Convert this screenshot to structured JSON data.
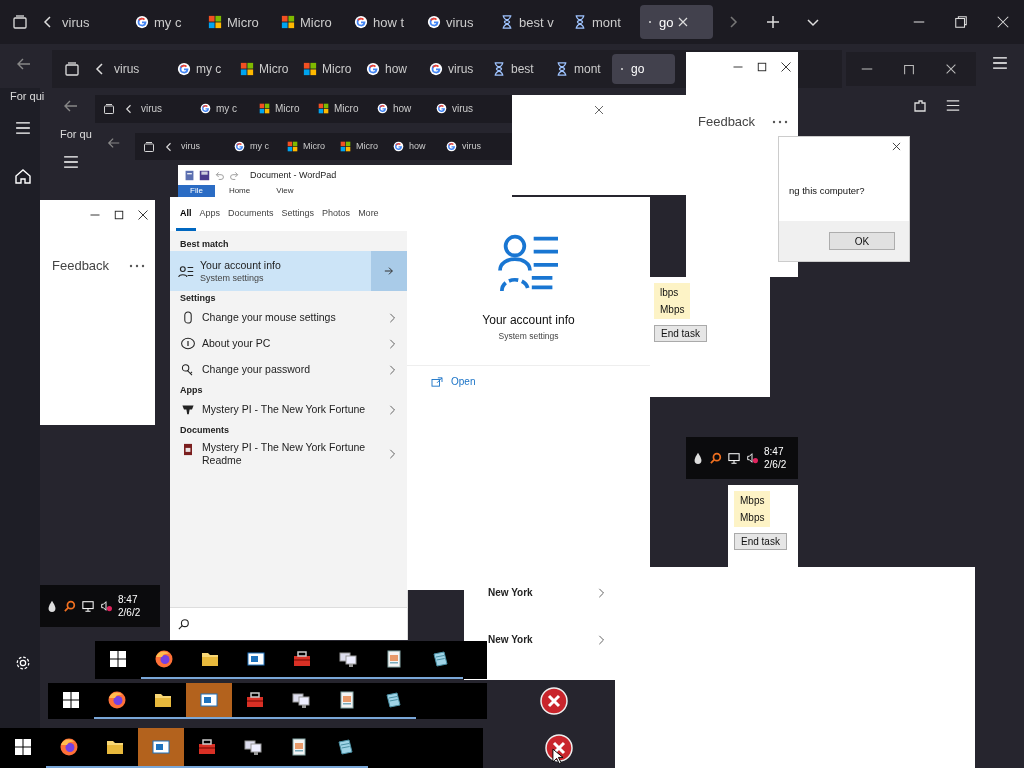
{
  "tab_bars": [
    {
      "tabs": [
        {
          "label": "virus",
          "kind": "none",
          "selected": false
        },
        {
          "label": "my c",
          "kind": "google",
          "selected": false
        },
        {
          "label": "Micro",
          "kind": "microsoft",
          "selected": false
        },
        {
          "label": "Micro",
          "kind": "microsoft",
          "selected": false
        },
        {
          "label": "how t",
          "kind": "google",
          "selected": false
        },
        {
          "label": "virus",
          "kind": "google",
          "selected": false
        },
        {
          "label": "best v",
          "kind": "hourglass",
          "selected": false
        },
        {
          "label": "mont",
          "kind": "hourglass",
          "selected": false
        },
        {
          "label": "go",
          "kind": "loading",
          "selected": true
        }
      ]
    },
    {
      "tabs": [
        {
          "label": "virus",
          "kind": "none",
          "selected": false
        },
        {
          "label": "my c",
          "kind": "google",
          "selected": false
        },
        {
          "label": "Micro",
          "kind": "microsoft",
          "selected": false
        },
        {
          "label": "Micro",
          "kind": "microsoft",
          "selected": false
        },
        {
          "label": "how",
          "kind": "google",
          "selected": false
        },
        {
          "label": "virus",
          "kind": "google",
          "selected": false
        },
        {
          "label": "best",
          "kind": "hourglass",
          "selected": false
        },
        {
          "label": "mont",
          "kind": "hourglass",
          "selected": false
        },
        {
          "label": "go",
          "kind": "loading",
          "selected": true
        }
      ]
    },
    {
      "tabs": [
        {
          "label": "virus",
          "kind": "none",
          "selected": false
        },
        {
          "label": "my c",
          "kind": "google",
          "selected": false
        },
        {
          "label": "Micro",
          "kind": "microsoft",
          "selected": false
        },
        {
          "label": "Micro",
          "kind": "microsoft",
          "selected": false
        },
        {
          "label": "how",
          "kind": "google",
          "selected": false
        },
        {
          "label": "virus",
          "kind": "google",
          "selected": false
        }
      ]
    },
    {
      "tabs": [
        {
          "label": "virus",
          "kind": "none",
          "selected": false
        },
        {
          "label": "my c",
          "kind": "google",
          "selected": false
        },
        {
          "label": "Micro",
          "kind": "microsoft",
          "selected": false
        },
        {
          "label": "Micro",
          "kind": "microsoft",
          "selected": false
        },
        {
          "label": "how",
          "kind": "google",
          "selected": false
        },
        {
          "label": "virus",
          "kind": "google",
          "selected": false
        }
      ]
    }
  ],
  "page_fragments": [
    "For qui",
    "For qu"
  ],
  "feedback_windows": [
    {
      "label": "Feedback"
    },
    {
      "label": "Feedback"
    }
  ],
  "wordpad": {
    "title": "Document - WordPad",
    "ribbon_tabs": [
      {
        "label": "File",
        "selected": true
      },
      {
        "label": "Home",
        "selected": false
      },
      {
        "label": "View",
        "selected": false
      }
    ]
  },
  "search_panel": {
    "tabs": [
      {
        "label": "All",
        "selected": true
      },
      {
        "label": "Apps",
        "selected": false
      },
      {
        "label": "Documents",
        "selected": false
      },
      {
        "label": "Settings",
        "selected": false
      },
      {
        "label": "Photos",
        "selected": false
      },
      {
        "label": "More",
        "selected": false
      }
    ],
    "sections": [
      {
        "heading": "Best match",
        "items": [
          {
            "kind": "account",
            "title": "Your account info",
            "subtitle": "System settings",
            "selected": true
          }
        ]
      },
      {
        "heading": "Settings",
        "items": [
          {
            "kind": "mouse",
            "title": "Change your mouse settings",
            "selected": false
          },
          {
            "kind": "info",
            "title": "About your PC",
            "selected": false
          },
          {
            "kind": "key",
            "title": "Change your password",
            "selected": false
          }
        ]
      },
      {
        "heading": "Apps",
        "items": [
          {
            "kind": "game",
            "title": "Mystery PI - The New York Fortune",
            "selected": false
          }
        ]
      },
      {
        "heading": "Documents",
        "items": [
          {
            "kind": "document",
            "title": "Mystery PI - The New York Fortune Readme",
            "selected": false
          }
        ]
      }
    ]
  },
  "preview": {
    "title": "Your account info",
    "subtitle": "System settings",
    "action": "Open"
  },
  "dialog": {
    "message": "ng this computer?",
    "button": "OK"
  },
  "task_manager_fragments": [
    {
      "speeds": [
        "lbps",
        "Mbps"
      ],
      "button": "End task"
    },
    {
      "speeds": [
        "Mbps",
        "Mbps"
      ],
      "button": "End task"
    }
  ],
  "clocks": [
    {
      "time": "8:47",
      "date": "2/6/2"
    },
    {
      "time": "8:47",
      "date": "2/6/2"
    }
  ],
  "results_fragments": [
    "New York",
    "New York"
  ],
  "taskbars": [
    {
      "items": [
        {
          "kind": "windows",
          "selected": false
        },
        {
          "kind": "firefox",
          "selected": false
        },
        {
          "kind": "folder",
          "selected": false
        },
        {
          "kind": "app",
          "selected": false
        },
        {
          "kind": "toolbox",
          "selected": false
        },
        {
          "kind": "monitor",
          "selected": false
        },
        {
          "kind": "notepad",
          "selected": false
        },
        {
          "kind": "pad",
          "selected": false
        }
      ]
    },
    {
      "items": [
        {
          "kind": "windows",
          "selected": false
        },
        {
          "kind": "firefox",
          "selected": false
        },
        {
          "kind": "folder",
          "selected": false
        },
        {
          "kind": "app",
          "selected": true
        },
        {
          "kind": "toolbox",
          "selected": false
        },
        {
          "kind": "monitor",
          "selected": false
        },
        {
          "kind": "notepad",
          "selected": false
        },
        {
          "kind": "pad",
          "selected": false
        }
      ]
    },
    {
      "items": [
        {
          "kind": "windows",
          "selected": false
        },
        {
          "kind": "firefox",
          "selected": false
        },
        {
          "kind": "folder",
          "selected": false
        },
        {
          "kind": "app",
          "selected": true
        },
        {
          "kind": "toolbox",
          "selected": false
        },
        {
          "kind": "monitor",
          "selected": false
        },
        {
          "kind": "notepad",
          "selected": false
        },
        {
          "kind": "pad",
          "selected": false
        }
      ]
    }
  ]
}
